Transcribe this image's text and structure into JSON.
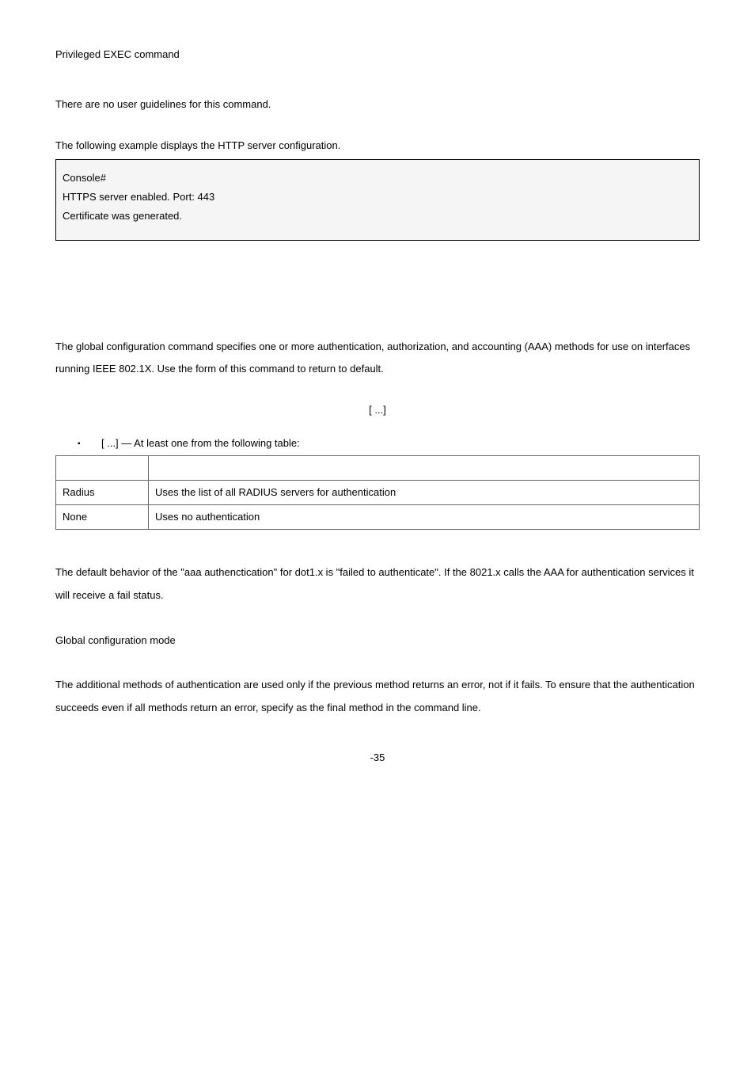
{
  "p1": "Privileged EXEC command",
  "p2": "There are no user guidelines for this command.",
  "p3": "The following example displays the HTTP server configuration.",
  "code": {
    "l1": "Console#",
    "l2": "HTTPS server enabled. Port: 443",
    "l3": "Certificate was generated."
  },
  "desc": {
    "pre": "The ",
    "mid": " global configuration command specifies one or more authentication, authorization, and accounting (AAA) methods for use on interfaces running IEEE 802.1X. Use the ",
    "post": " form of this command to return to default."
  },
  "syntax": "[             ...]",
  "bullet": {
    "br": "[              ...] — At least one from the following table:"
  },
  "table": {
    "r1k": "Radius",
    "r1v": "Uses the list of all RADIUS servers for authentication",
    "r2k": "None",
    "r2v": "Uses no authentication"
  },
  "default_p": "The default behavior of the \"aaa authenctication\" for dot1.x is \"failed to authenticate\". If the 8021.x calls the AAA for authentication services it will receive a fail status.",
  "mode_p": "Global configuration mode",
  "guide": {
    "a": "The additional methods of authentication are used only if the previous method returns an error, not if it fails. To ensure that the authentication succeeds even if all methods return an error, specify ",
    "b": " as the final method in the command line."
  },
  "pagenum": "-35"
}
